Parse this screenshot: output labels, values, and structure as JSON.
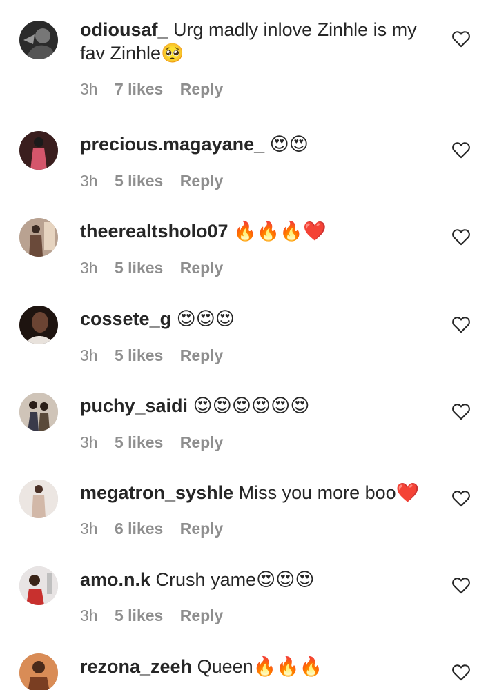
{
  "comments": [
    {
      "username": "odiousaf_",
      "text": "Urg madly inlove Zinhle is my fav Zinhle🥺",
      "time": "3h",
      "likes": "7 likes",
      "reply": "Reply",
      "avatar_color": "#3a3a3a"
    },
    {
      "username": "precious.magayane_",
      "text": "😍😍",
      "time": "3h",
      "likes": "5 likes",
      "reply": "Reply",
      "avatar_color": "#7a2f2a"
    },
    {
      "username": "theerealtsholo07",
      "text": "🔥🔥🔥❤️",
      "time": "3h",
      "likes": "5 likes",
      "reply": "Reply",
      "avatar_color": "#8a6a55"
    },
    {
      "username": "cossete_g",
      "text": "😍😍😍",
      "time": "3h",
      "likes": "5 likes",
      "reply": "Reply",
      "avatar_color": "#3b2a22"
    },
    {
      "username": "puchy_saidi",
      "text": "😍😍😍😍😍😍",
      "time": "3h",
      "likes": "5 likes",
      "reply": "Reply",
      "avatar_color": "#8a7a6a"
    },
    {
      "username": "megatron_syshle",
      "text": "Miss you more boo❤️",
      "time": "3h",
      "likes": "6 likes",
      "reply": "Reply",
      "avatar_color": "#d8c8c0"
    },
    {
      "username": "amo.n.k",
      "text": "Crush yame😍😍😍",
      "time": "3h",
      "likes": "5 likes",
      "reply": "Reply",
      "avatar_color": "#c9b7b7"
    },
    {
      "username": "rezona_zeeh",
      "text": "Queen🔥🔥🔥",
      "time": "",
      "likes": "",
      "reply": "",
      "avatar_color": "#c46a3a"
    }
  ]
}
